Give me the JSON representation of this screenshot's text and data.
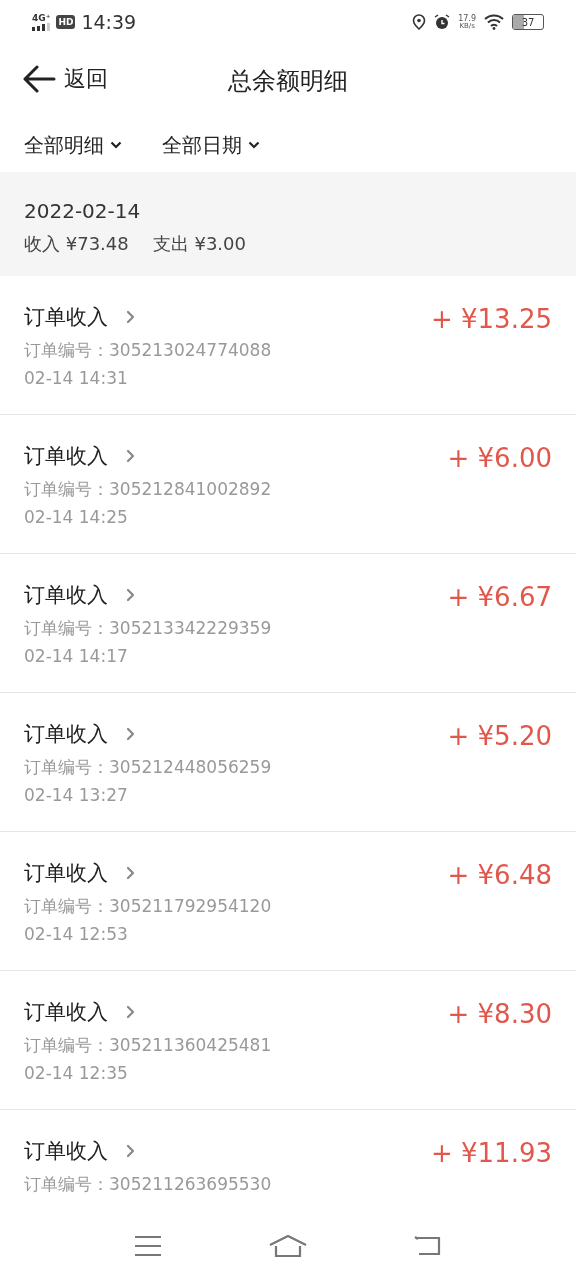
{
  "status_bar": {
    "network": "4G⁺",
    "hd": "HD",
    "time": "14:39",
    "speed": "17.9",
    "speed_unit": "KB/s",
    "battery": "37"
  },
  "header": {
    "back": "返回",
    "title": "总余额明细"
  },
  "filters": [
    {
      "label": "全部明细"
    },
    {
      "label": "全部日期"
    }
  ],
  "summary": {
    "date": "2022-02-14",
    "income": "收入 ¥73.48",
    "expense": "支出 ¥3.00"
  },
  "rows": [
    {
      "title": "订单收入",
      "order": "订单编号：305213024774088",
      "time": "02-14 14:31",
      "amount": "+ ¥13.25"
    },
    {
      "title": "订单收入",
      "order": "订单编号：305212841002892",
      "time": "02-14 14:25",
      "amount": "+ ¥6.00"
    },
    {
      "title": "订单收入",
      "order": "订单编号：305213342229359",
      "time": "02-14 14:17",
      "amount": "+ ¥6.67"
    },
    {
      "title": "订单收入",
      "order": "订单编号：305212448056259",
      "time": "02-14 13:27",
      "amount": "+ ¥5.20"
    },
    {
      "title": "订单收入",
      "order": "订单编号：305211792954120",
      "time": "02-14 12:53",
      "amount": "+ ¥6.48"
    },
    {
      "title": "订单收入",
      "order": "订单编号：305211360425481",
      "time": "02-14 12:35",
      "amount": "+ ¥8.30"
    },
    {
      "title": "订单收入",
      "order": "订单编号：305211263695530",
      "amount": "+ ¥11.93"
    }
  ]
}
